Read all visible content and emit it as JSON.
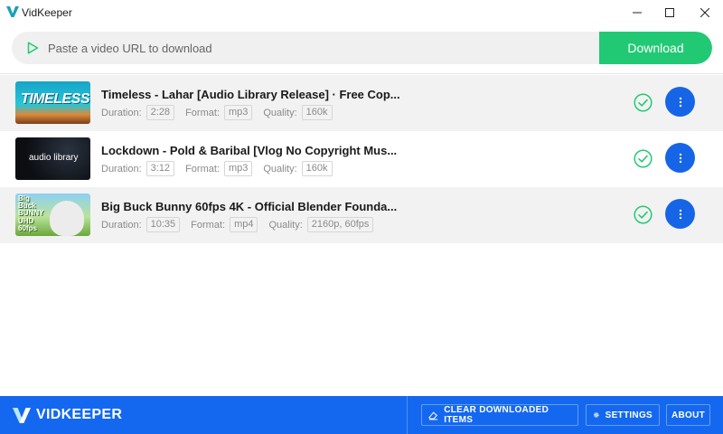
{
  "window": {
    "title": "VidKeeper"
  },
  "urlbar": {
    "placeholder": "Paste a video URL to download",
    "value": "",
    "download_label": "Download"
  },
  "labels": {
    "duration": "Duration:",
    "format": "Format:",
    "quality": "Quality:"
  },
  "items": [
    {
      "title": "Timeless - Lahar [Audio Library Release] · Free Cop...",
      "duration": "2:28",
      "format": "mp3",
      "quality": "160k",
      "thumb_text": "TIMELESS"
    },
    {
      "title": "Lockdown - Pold & Baribal [Vlog No Copyright Mus...",
      "duration": "3:12",
      "format": "mp3",
      "quality": "160k",
      "thumb_text": "audio library"
    },
    {
      "title": "Big Buck Bunny 60fps 4K - Official Blender Founda...",
      "duration": "10:35",
      "format": "mp4",
      "quality": "2160p, 60fps",
      "thumb_text_top": "Big Buck BUNNY",
      "thumb_text_bottom": "UHD 60fps"
    }
  ],
  "footer": {
    "brand": "VIDKEEPER",
    "clear_label": "CLEAR DOWNLOADED ITEMS",
    "settings_label": "SETTINGS",
    "about_label": "ABOUT"
  },
  "colors": {
    "accent_green": "#22c974",
    "accent_blue": "#1468f0",
    "action_blue": "#1565e6"
  }
}
